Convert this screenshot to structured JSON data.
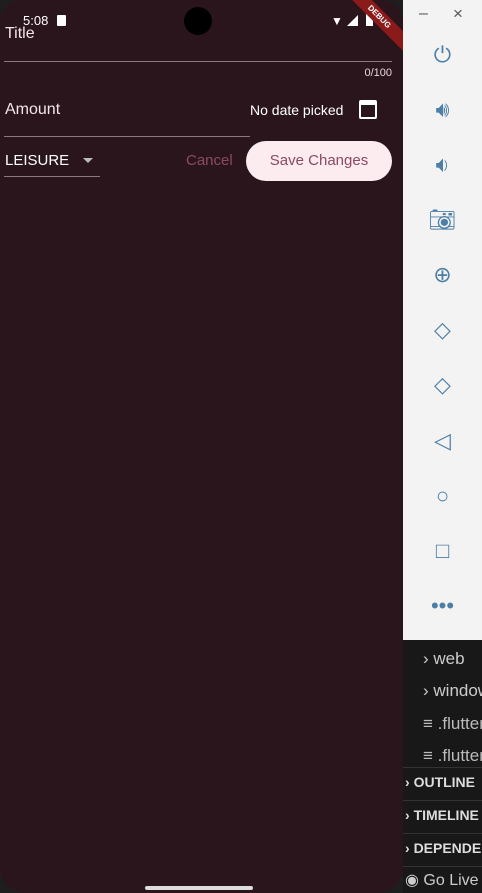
{
  "status_bar": {
    "time": "5:08",
    "debug_banner": "DEBUG"
  },
  "form": {
    "title_label": "Title",
    "title_counter": "0/100",
    "amount_label": "Amount",
    "date_text": "No date picked",
    "category_value": "LEISURE",
    "cancel_label": "Cancel",
    "save_label": "Save Changes"
  },
  "emulator_toolbar": {
    "minimize": "–",
    "close": "×",
    "icons": [
      "power-icon",
      "volume-up-icon",
      "volume-down-icon",
      "camera-icon",
      "zoom-icon",
      "rotate-left-icon",
      "rotate-right-icon",
      "back-icon",
      "home-icon",
      "overview-icon",
      "more-icon"
    ]
  },
  "explorer": {
    "items": [
      "web",
      "windows",
      ".flutter-plugins",
      ".flutter-plugins-dependencies"
    ],
    "sections": [
      "OUTLINE",
      "TIMELINE",
      "DEPENDENCIES"
    ],
    "status": "Go Live"
  },
  "colors": {
    "background": "#2b151d",
    "accent": "#8b4a62",
    "button_bg": "#fcebef",
    "icon": "#4d7fa6"
  }
}
